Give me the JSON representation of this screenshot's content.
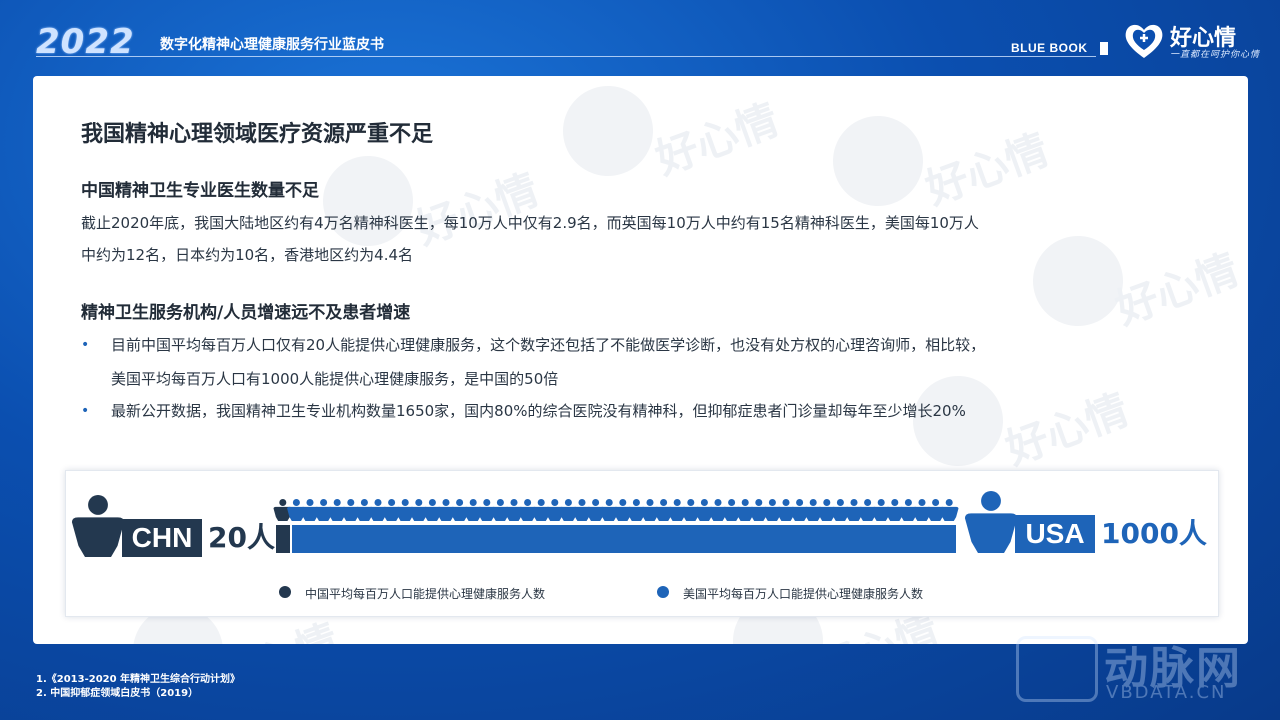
{
  "header": {
    "year": "2022",
    "subtitle": "数字化精神心理健康服务行业蓝皮书",
    "blue_book": "BLUE BOOK",
    "logo_name": "好心情",
    "logo_slogan": "一直都在呵护你心情"
  },
  "content": {
    "title": "我国精神心理领域医疗资源严重不足",
    "section1": {
      "heading": "中国精神卫生专业医生数量不足",
      "line1": "截止2020年底，我国大陆地区约有4万名精神科医生，每10万人中仅有2.9名，而英国每10万人中约有15名精神科医生，美国每10万人",
      "line2": "中约为12名，日本约为10名，香港地区约为4.4名"
    },
    "section2": {
      "heading": "精神卫生服务机构/人员增速远不及患者增速",
      "bullet1_line1": "目前中国平均每百万人口仅有20人能提供心理健康服务，这个数字还包括了不能做医学诊断，也没有处方权的心理咨询师，相比较，",
      "bullet1_line2": "美国平均每百万人口有1000人能提供心理健康服务，是中国的50倍",
      "bullet2": "最新公开数据，我国精神卫生专业机构数量1650家，国内80%的综合医院没有精神科，但抑郁症患者门诊量却每年至少增长20%",
      "bullet_marker": "•"
    }
  },
  "chart_data": {
    "type": "bar",
    "orientation": "horizontal",
    "categories": [
      "CHN",
      "USA"
    ],
    "values": [
      20,
      1000
    ],
    "value_labels": [
      "20人",
      "1000人"
    ],
    "series": [
      {
        "name": "中国平均每百万人口能提供心理健康服务人数",
        "values": [
          20
        ],
        "color": "#23384f"
      },
      {
        "name": "美国平均每百万人口能提供心理健康服务人数",
        "values": [
          1000
        ],
        "color": "#1e64b8"
      }
    ],
    "legend_position": "bottom"
  },
  "footnotes": {
    "f1": "1.《2013-2020 年精神卫生综合行动计划》",
    "f2": "2. 中国抑郁症领域白皮书（2019）"
  },
  "watermark": {
    "text": "好心情",
    "brand_text": "动脉网",
    "brand_sub": "VBDATA.CN"
  }
}
